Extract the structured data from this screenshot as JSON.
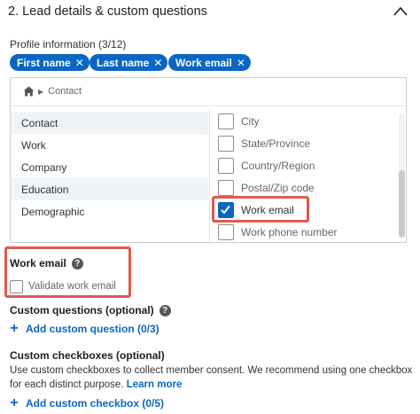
{
  "section": {
    "title": "2.  Lead details & custom questions",
    "collapse_icon": "chevron-up-icon"
  },
  "profile": {
    "label": "Profile information (3/12)",
    "chips": [
      {
        "label": "First name"
      },
      {
        "label": "Last name"
      },
      {
        "label": "Work email"
      }
    ],
    "chip_remove_glyph": "✕"
  },
  "selector": {
    "breadcrumb": {
      "home_icon": "home-icon",
      "current": "Contact"
    },
    "categories": [
      {
        "label": "Contact",
        "active": true
      },
      {
        "label": "Work",
        "active": false
      },
      {
        "label": "Company",
        "active": false
      },
      {
        "label": "Education",
        "active": true
      },
      {
        "label": "Demographic",
        "active": false
      }
    ],
    "fields": [
      {
        "label": "City",
        "checked": false
      },
      {
        "label": "State/Province",
        "checked": false
      },
      {
        "label": "Country/Region",
        "checked": false
      },
      {
        "label": "Postal/Zip code",
        "checked": false
      },
      {
        "label": "Work email",
        "checked": true
      },
      {
        "label": "Work phone number",
        "checked": false
      }
    ]
  },
  "work_email": {
    "title": "Work email",
    "help_glyph": "?",
    "validate_label": "Validate work email",
    "validate_checked": false
  },
  "custom_questions": {
    "title": "Custom questions (optional)",
    "help_glyph": "?",
    "add_label": "Add custom question (0/3)"
  },
  "custom_checkboxes": {
    "title": "Custom checkboxes (optional)",
    "description": "Use custom checkboxes to collect member consent. We recommend using one checkbox for each distinct purpose.",
    "learn_more": "Learn more",
    "add_label": "Add custom checkbox (0/5)"
  },
  "colors": {
    "accent": "#0a66c2",
    "highlight": "#e35a4d",
    "active_row": "#eef3f8"
  }
}
